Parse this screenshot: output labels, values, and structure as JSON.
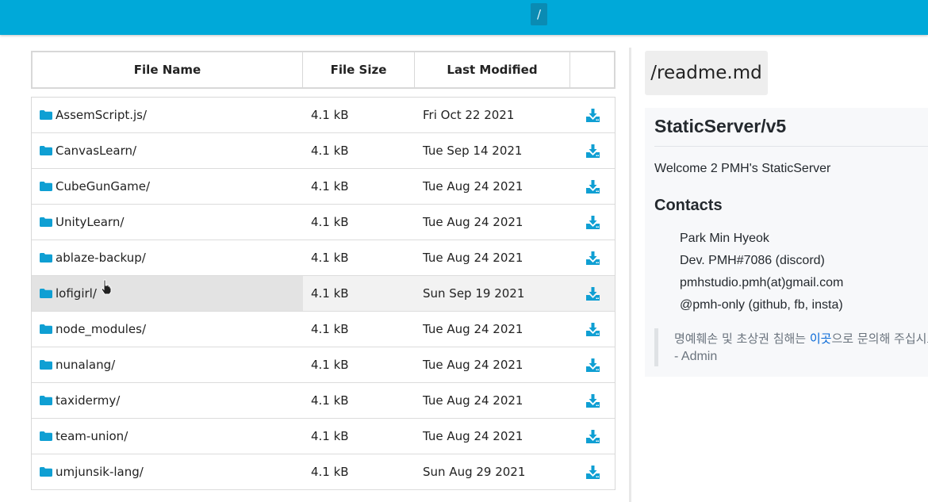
{
  "topbar": {
    "path": "/"
  },
  "table": {
    "headers": [
      "File Name",
      "File Size",
      "Last Modified",
      ""
    ],
    "rows": [
      {
        "name": "AssemScript.js/",
        "size": "4.1 kB",
        "date": "Fri Oct 22 2021"
      },
      {
        "name": "CanvasLearn/",
        "size": "4.1 kB",
        "date": "Tue Sep 14 2021"
      },
      {
        "name": "CubeGunGame/",
        "size": "4.1 kB",
        "date": "Tue Aug 24 2021"
      },
      {
        "name": "UnityLearn/",
        "size": "4.1 kB",
        "date": "Tue Aug 24 2021"
      },
      {
        "name": "ablaze-backup/",
        "size": "4.1 kB",
        "date": "Tue Aug 24 2021"
      },
      {
        "name": "lofigirl/",
        "size": "4.1 kB",
        "date": "Sun Sep 19 2021"
      },
      {
        "name": "node_modules/",
        "size": "4.1 kB",
        "date": "Tue Aug 24 2021"
      },
      {
        "name": "nunalang/",
        "size": "4.1 kB",
        "date": "Tue Aug 24 2021"
      },
      {
        "name": "taxidermy/",
        "size": "4.1 kB",
        "date": "Tue Aug 24 2021"
      },
      {
        "name": "team-union/",
        "size": "4.1 kB",
        "date": "Tue Aug 24 2021"
      },
      {
        "name": "umjunsik-lang/",
        "size": "4.1 kB",
        "date": "Sun Aug 29 2021"
      }
    ]
  },
  "readme": {
    "path": "/readme.md",
    "title": "StaticServer/v5",
    "welcome": "Welcome 2 PMH's StaticServer",
    "contacts_heading": "Contacts",
    "contacts": [
      "Park Min Hyeok",
      "Dev. PMH#7086 (discord)",
      "pmhstudio.pmh(at)gmail.com",
      "@pmh-only (github, fb, insta)"
    ],
    "quote_before": "명예훼손 및 초상권 침해는 ",
    "quote_link": "이곳",
    "quote_after": "으로 문의해 주십시오",
    "quote_sign": "- Admin"
  },
  "colors": {
    "accent": "#00a9d9",
    "icon": "#0f9fd3",
    "link": "#0366d6"
  },
  "icons": {
    "folder": "folder-icon",
    "download": "download-icon"
  }
}
